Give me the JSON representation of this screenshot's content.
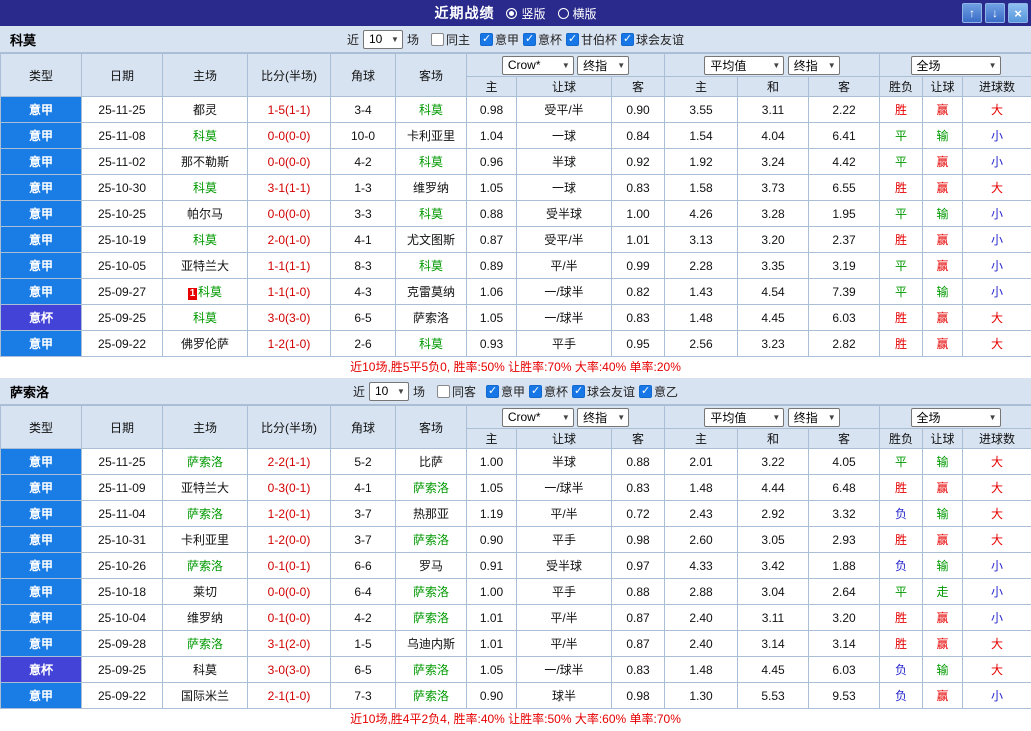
{
  "titlebar": {
    "title": "近期战绩",
    "view_options": [
      {
        "label": "竖版",
        "selected": true
      },
      {
        "label": "横版",
        "selected": false
      }
    ],
    "up_icon": "↑",
    "down_icon": "↓",
    "close_icon": "×"
  },
  "table_header": {
    "col_type": "类型",
    "col_date": "日期",
    "col_home": "主场",
    "col_score": "比分(半场)",
    "col_corner": "角球",
    "col_away": "客场",
    "dd_bookmaker": "Crow*",
    "dd_final_ah": "终指",
    "dd_average": "平均值",
    "dd_final_eu": "终指",
    "dd_scope": "全场",
    "col_ah_home": "主",
    "col_ah_line": "让球",
    "col_ah_away": "客",
    "col_eu_home": "主",
    "col_eu_draw": "和",
    "col_eu_away": "客",
    "col_result": "胜负",
    "col_handicap": "让球",
    "col_goals": "进球数"
  },
  "colors": {
    "league": {
      "意甲": "#1a7de6",
      "意杯": "#4343d8"
    },
    "result": {
      "胜": "#e60000",
      "平": "#009900",
      "负": "#2626cc"
    },
    "handicap": {
      "赢": "#e60000",
      "输": "#009900",
      "走": "#009900"
    },
    "goals": {
      "大": "#e60000",
      "小": "#2626cc"
    },
    "team_highlight": "#009900",
    "score": "#d10000",
    "summary": "#e60000",
    "titlebar_bg": "#2a2a8c",
    "header_bg": "#d8e3f1"
  },
  "sections": [
    {
      "team": "科莫",
      "filter": {
        "near": "近",
        "count": "10",
        "games": "场",
        "same": "同主",
        "same_checked": false,
        "leagues": [
          "意甲",
          "意杯",
          "甘伯杯",
          "球会友谊"
        ],
        "league_checked": [
          true,
          true,
          true,
          true
        ]
      },
      "summary": "近10场,胜5平5负0, 胜率:50% 让胜率:70% 大率:40% 单率:20%",
      "rows": [
        {
          "league": "意甲",
          "date": "25-11-25",
          "home": "都灵",
          "homeHL": false,
          "badge": "",
          "score": "1-5(1-1)",
          "corner": "3-4",
          "away": "科莫",
          "awayHL": true,
          "ah": [
            "0.98",
            "受平/半",
            "0.90"
          ],
          "eu": [
            "3.55",
            "3.11",
            "2.22"
          ],
          "res": "胜",
          "hc": "赢",
          "goal": "大"
        },
        {
          "league": "意甲",
          "date": "25-11-08",
          "home": "科莫",
          "homeHL": true,
          "badge": "",
          "score": "0-0(0-0)",
          "corner": "10-0",
          "away": "卡利亚里",
          "awayHL": false,
          "ah": [
            "1.04",
            "一球",
            "0.84"
          ],
          "eu": [
            "1.54",
            "4.04",
            "6.41"
          ],
          "res": "平",
          "hc": "输",
          "goal": "小"
        },
        {
          "league": "意甲",
          "date": "25-11-02",
          "home": "那不勒斯",
          "homeHL": false,
          "badge": "",
          "score": "0-0(0-0)",
          "corner": "4-2",
          "away": "科莫",
          "awayHL": true,
          "ah": [
            "0.96",
            "半球",
            "0.92"
          ],
          "eu": [
            "1.92",
            "3.24",
            "4.42"
          ],
          "res": "平",
          "hc": "赢",
          "goal": "小"
        },
        {
          "league": "意甲",
          "date": "25-10-30",
          "home": "科莫",
          "homeHL": true,
          "badge": "",
          "score": "3-1(1-1)",
          "corner": "1-3",
          "away": "维罗纳",
          "awayHL": false,
          "ah": [
            "1.05",
            "一球",
            "0.83"
          ],
          "eu": [
            "1.58",
            "3.73",
            "6.55"
          ],
          "res": "胜",
          "hc": "赢",
          "goal": "大"
        },
        {
          "league": "意甲",
          "date": "25-10-25",
          "home": "帕尔马",
          "homeHL": false,
          "badge": "",
          "score": "0-0(0-0)",
          "corner": "3-3",
          "away": "科莫",
          "awayHL": true,
          "ah": [
            "0.88",
            "受半球",
            "1.00"
          ],
          "eu": [
            "4.26",
            "3.28",
            "1.95"
          ],
          "res": "平",
          "hc": "输",
          "goal": "小"
        },
        {
          "league": "意甲",
          "date": "25-10-19",
          "home": "科莫",
          "homeHL": true,
          "badge": "",
          "score": "2-0(1-0)",
          "corner": "4-1",
          "away": "尤文图斯",
          "awayHL": false,
          "ah": [
            "0.87",
            "受平/半",
            "1.01"
          ],
          "eu": [
            "3.13",
            "3.20",
            "2.37"
          ],
          "res": "胜",
          "hc": "赢",
          "goal": "小"
        },
        {
          "league": "意甲",
          "date": "25-10-05",
          "home": "亚特兰大",
          "homeHL": false,
          "badge": "",
          "score": "1-1(1-1)",
          "corner": "8-3",
          "away": "科莫",
          "awayHL": true,
          "ah": [
            "0.89",
            "平/半",
            "0.99"
          ],
          "eu": [
            "2.28",
            "3.35",
            "3.19"
          ],
          "res": "平",
          "hc": "赢",
          "goal": "小"
        },
        {
          "league": "意甲",
          "date": "25-09-27",
          "home": "科莫",
          "homeHL": true,
          "badge": "1",
          "score": "1-1(1-0)",
          "corner": "4-3",
          "away": "克雷莫纳",
          "awayHL": false,
          "ah": [
            "1.06",
            "一/球半",
            "0.82"
          ],
          "eu": [
            "1.43",
            "4.54",
            "7.39"
          ],
          "res": "平",
          "hc": "输",
          "goal": "小"
        },
        {
          "league": "意杯",
          "date": "25-09-25",
          "home": "科莫",
          "homeHL": true,
          "badge": "",
          "score": "3-0(3-0)",
          "corner": "6-5",
          "away": "萨索洛",
          "awayHL": false,
          "ah": [
            "1.05",
            "一/球半",
            "0.83"
          ],
          "eu": [
            "1.48",
            "4.45",
            "6.03"
          ],
          "res": "胜",
          "hc": "赢",
          "goal": "大"
        },
        {
          "league": "意甲",
          "date": "25-09-22",
          "home": "佛罗伦萨",
          "homeHL": false,
          "badge": "",
          "score": "1-2(1-0)",
          "corner": "2-6",
          "away": "科莫",
          "awayHL": true,
          "ah": [
            "0.93",
            "平手",
            "0.95"
          ],
          "eu": [
            "2.56",
            "3.23",
            "2.82"
          ],
          "res": "胜",
          "hc": "赢",
          "goal": "大"
        }
      ]
    },
    {
      "team": "萨索洛",
      "filter": {
        "near": "近",
        "count": "10",
        "games": "场",
        "same": "同客",
        "same_checked": false,
        "leagues": [
          "意甲",
          "意杯",
          "球会友谊",
          "意乙"
        ],
        "league_checked": [
          true,
          true,
          true,
          true
        ]
      },
      "summary": "近10场,胜4平2负4, 胜率:40% 让胜率:50% 大率:60% 单率:70%",
      "rows": [
        {
          "league": "意甲",
          "date": "25-11-25",
          "home": "萨索洛",
          "homeHL": true,
          "badge": "",
          "score": "2-2(1-1)",
          "corner": "5-2",
          "away": "比萨",
          "awayHL": false,
          "ah": [
            "1.00",
            "半球",
            "0.88"
          ],
          "eu": [
            "2.01",
            "3.22",
            "4.05"
          ],
          "res": "平",
          "hc": "输",
          "goal": "大"
        },
        {
          "league": "意甲",
          "date": "25-11-09",
          "home": "亚特兰大",
          "homeHL": false,
          "badge": "",
          "score": "0-3(0-1)",
          "corner": "4-1",
          "away": "萨索洛",
          "awayHL": true,
          "ah": [
            "1.05",
            "一/球半",
            "0.83"
          ],
          "eu": [
            "1.48",
            "4.44",
            "6.48"
          ],
          "res": "胜",
          "hc": "赢",
          "goal": "大"
        },
        {
          "league": "意甲",
          "date": "25-11-04",
          "home": "萨索洛",
          "homeHL": true,
          "badge": "",
          "score": "1-2(0-1)",
          "corner": "3-7",
          "away": "热那亚",
          "awayHL": false,
          "ah": [
            "1.19",
            "平/半",
            "0.72"
          ],
          "eu": [
            "2.43",
            "2.92",
            "3.32"
          ],
          "res": "负",
          "hc": "输",
          "goal": "大"
        },
        {
          "league": "意甲",
          "date": "25-10-31",
          "home": "卡利亚里",
          "homeHL": false,
          "badge": "",
          "score": "1-2(0-0)",
          "corner": "3-7",
          "away": "萨索洛",
          "awayHL": true,
          "ah": [
            "0.90",
            "平手",
            "0.98"
          ],
          "eu": [
            "2.60",
            "3.05",
            "2.93"
          ],
          "res": "胜",
          "hc": "赢",
          "goal": "大"
        },
        {
          "league": "意甲",
          "date": "25-10-26",
          "home": "萨索洛",
          "homeHL": true,
          "badge": "",
          "score": "0-1(0-1)",
          "corner": "6-6",
          "away": "罗马",
          "awayHL": false,
          "ah": [
            "0.91",
            "受半球",
            "0.97"
          ],
          "eu": [
            "4.33",
            "3.42",
            "1.88"
          ],
          "res": "负",
          "hc": "输",
          "goal": "小"
        },
        {
          "league": "意甲",
          "date": "25-10-18",
          "home": "莱切",
          "homeHL": false,
          "badge": "",
          "score": "0-0(0-0)",
          "corner": "6-4",
          "away": "萨索洛",
          "awayHL": true,
          "ah": [
            "1.00",
            "平手",
            "0.88"
          ],
          "eu": [
            "2.88",
            "3.04",
            "2.64"
          ],
          "res": "平",
          "hc": "走",
          "goal": "小"
        },
        {
          "league": "意甲",
          "date": "25-10-04",
          "home": "维罗纳",
          "homeHL": false,
          "badge": "",
          "score": "0-1(0-0)",
          "corner": "4-2",
          "away": "萨索洛",
          "awayHL": true,
          "ah": [
            "1.01",
            "平/半",
            "0.87"
          ],
          "eu": [
            "2.40",
            "3.11",
            "3.20"
          ],
          "res": "胜",
          "hc": "赢",
          "goal": "小"
        },
        {
          "league": "意甲",
          "date": "25-09-28",
          "home": "萨索洛",
          "homeHL": true,
          "badge": "",
          "score": "3-1(2-0)",
          "corner": "1-5",
          "away": "乌迪内斯",
          "awayHL": false,
          "ah": [
            "1.01",
            "平/半",
            "0.87"
          ],
          "eu": [
            "2.40",
            "3.14",
            "3.14"
          ],
          "res": "胜",
          "hc": "赢",
          "goal": "大"
        },
        {
          "league": "意杯",
          "date": "25-09-25",
          "home": "科莫",
          "homeHL": false,
          "badge": "",
          "score": "3-0(3-0)",
          "corner": "6-5",
          "away": "萨索洛",
          "awayHL": true,
          "ah": [
            "1.05",
            "一/球半",
            "0.83"
          ],
          "eu": [
            "1.48",
            "4.45",
            "6.03"
          ],
          "res": "负",
          "hc": "输",
          "goal": "大"
        },
        {
          "league": "意甲",
          "date": "25-09-22",
          "home": "国际米兰",
          "homeHL": false,
          "badge": "",
          "score": "2-1(1-0)",
          "corner": "7-3",
          "away": "萨索洛",
          "awayHL": true,
          "ah": [
            "0.90",
            "球半",
            "0.98"
          ],
          "eu": [
            "1.30",
            "5.53",
            "9.53"
          ],
          "res": "负",
          "hc": "赢",
          "goal": "小"
        }
      ]
    }
  ]
}
